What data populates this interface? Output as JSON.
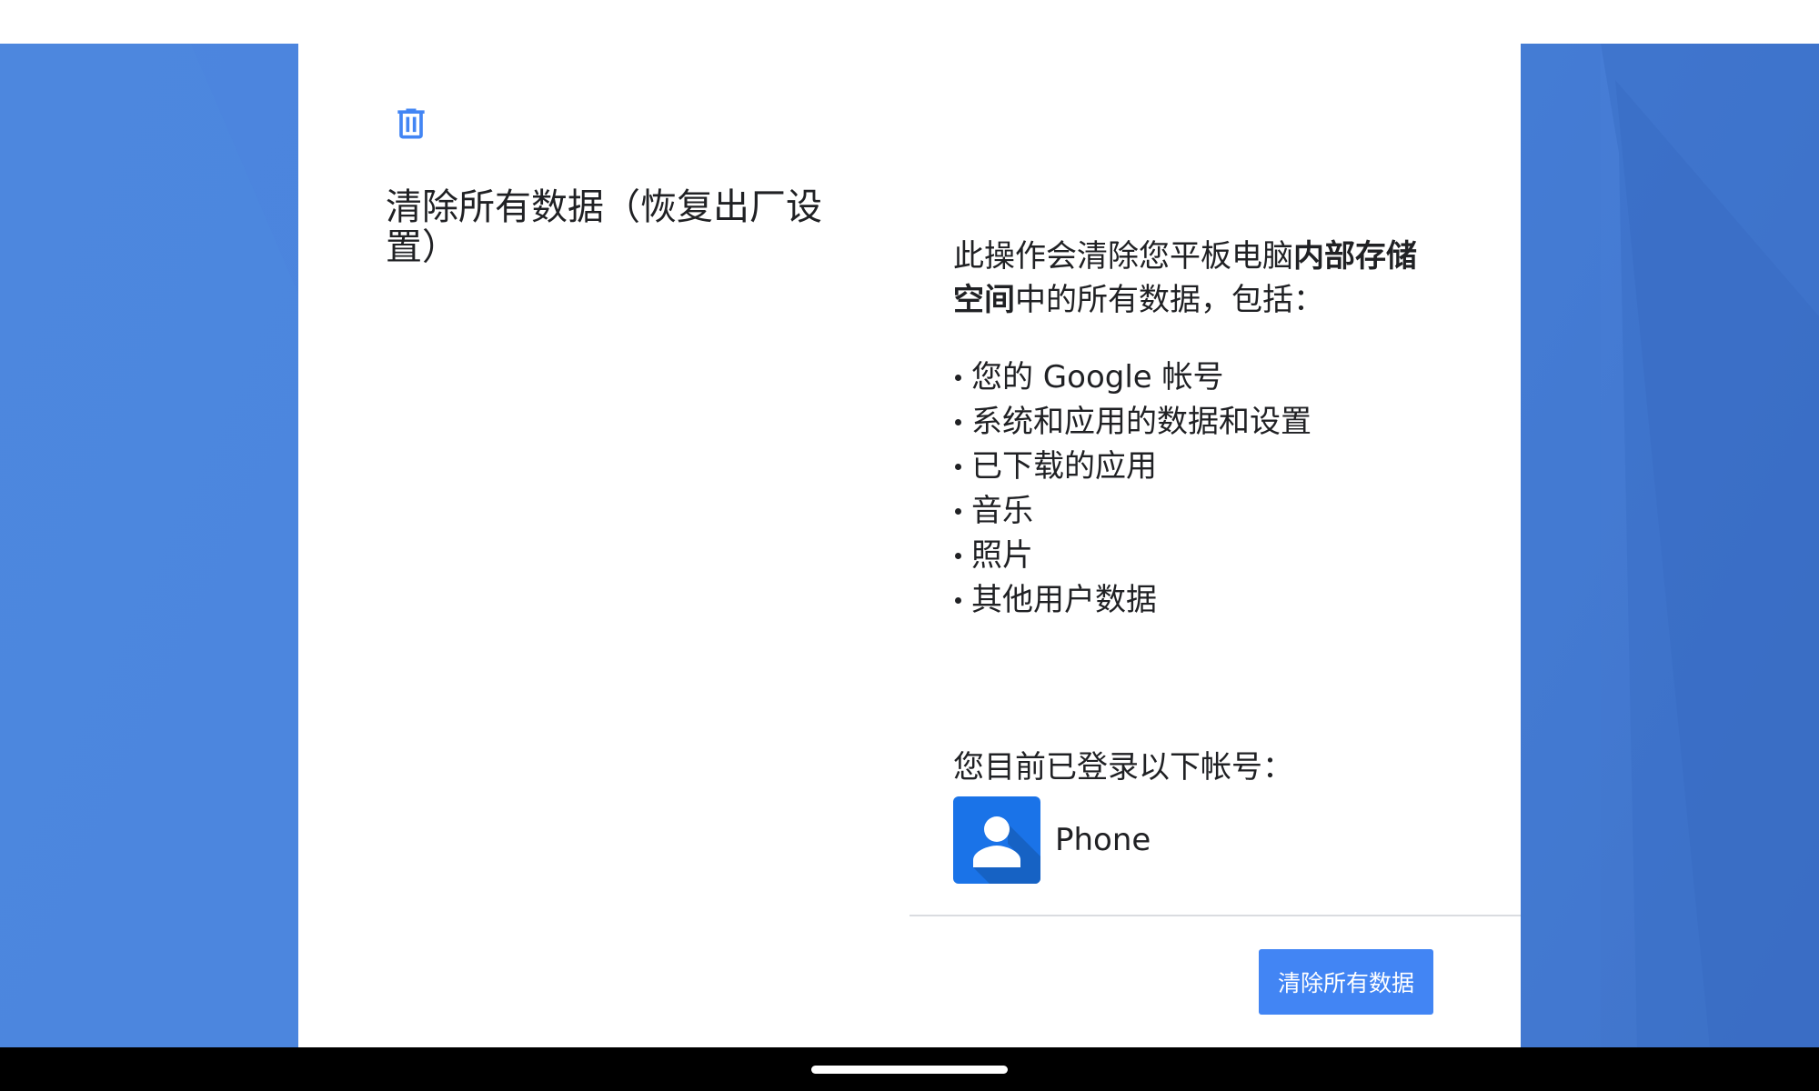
{
  "theme": {
    "accent": "#4285f4",
    "wallpaper": "#4a82dc",
    "text": "#202124"
  },
  "page": {
    "icon": "delete-trash-icon",
    "title": "清除所有数据（恢复出厂设置）"
  },
  "details": {
    "intro_prefix": "此操作会清除您平板电脑",
    "intro_bold": "内部存储空间",
    "intro_suffix": "中的所有数据，包括：",
    "items": [
      "您的 Google 帐号",
      "系统和应用的数据和设置",
      "已下载的应用",
      "音乐",
      "照片",
      "其他用户数据"
    ],
    "accounts_label": "您目前已登录以下帐号：",
    "accounts": [
      {
        "icon": "person-avatar-icon",
        "name": "Phone"
      }
    ]
  },
  "actions": {
    "erase_label": "清除所有数据"
  },
  "nav": {
    "handle": "home-gesture-handle"
  }
}
